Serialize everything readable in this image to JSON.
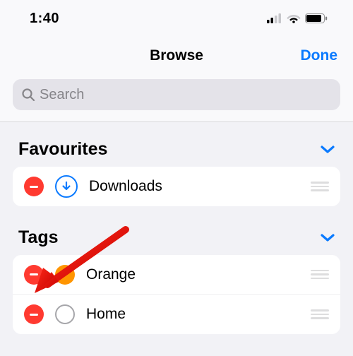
{
  "status": {
    "time": "1:40"
  },
  "nav": {
    "title": "Browse",
    "done": "Done"
  },
  "search": {
    "placeholder": "Search"
  },
  "sections": {
    "favourites": {
      "title": "Favourites",
      "items": {
        "downloads": {
          "label": "Downloads"
        }
      }
    },
    "tags": {
      "title": "Tags",
      "items": {
        "orange": {
          "label": "Orange",
          "color": "#ff9500"
        },
        "home": {
          "label": "Home"
        }
      }
    }
  }
}
